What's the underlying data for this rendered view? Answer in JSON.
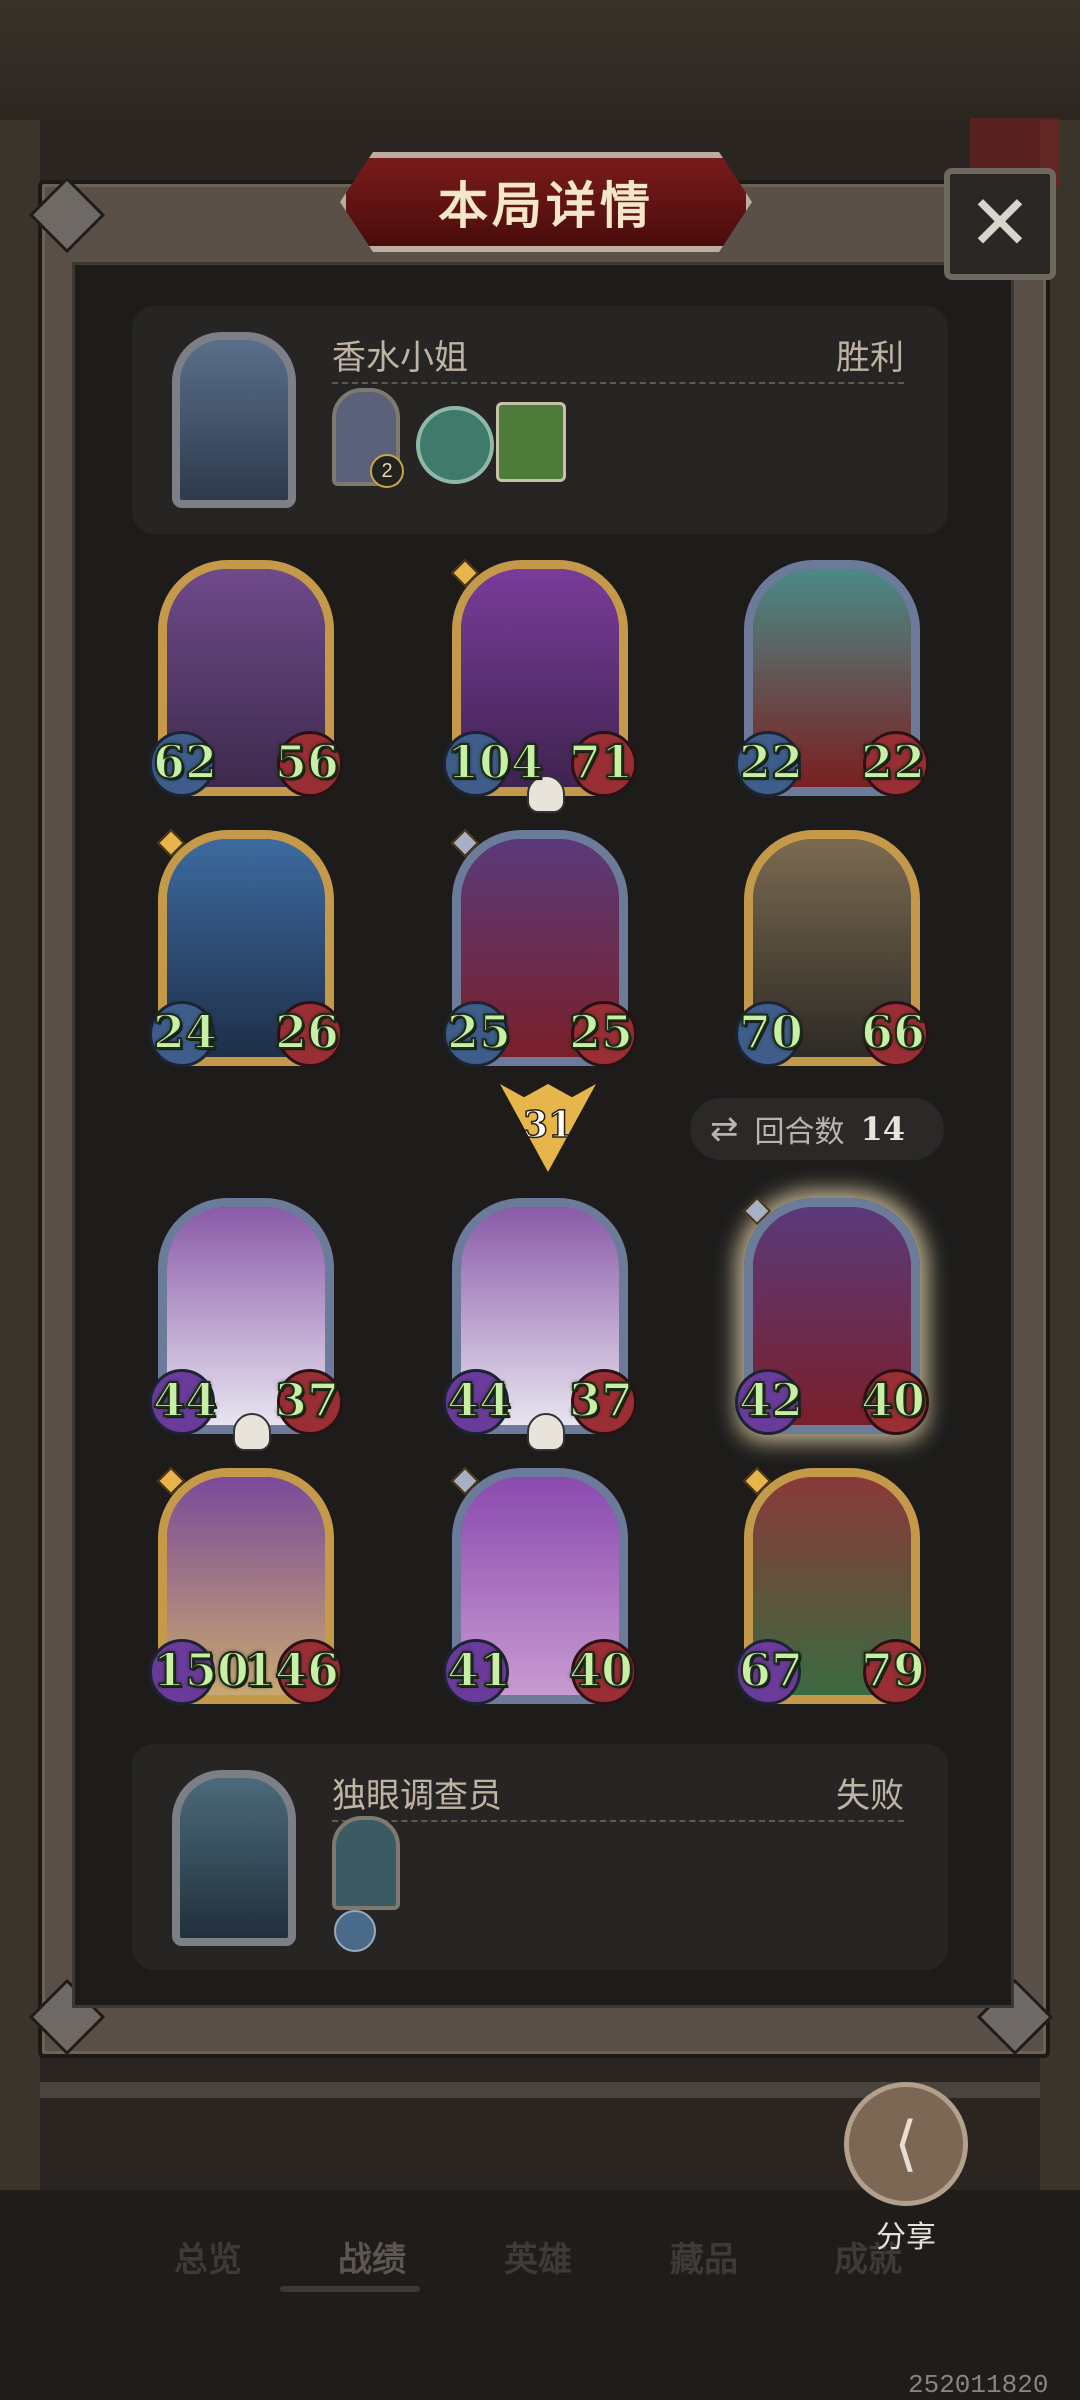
{
  "header": {
    "title": "本局详情",
    "close_icon": "close-icon"
  },
  "winner": {
    "name": "香水小姐",
    "result": "胜利",
    "item_badge": "2"
  },
  "loser": {
    "name": "独眼调查员",
    "result": "失败"
  },
  "winner_cards": [
    {
      "attack": "62",
      "health": "56"
    },
    {
      "attack": "104",
      "health": "71"
    },
    {
      "attack": "22",
      "health": "22"
    },
    {
      "attack": "24",
      "health": "26"
    },
    {
      "attack": "25",
      "health": "25"
    },
    {
      "attack": "70",
      "health": "66"
    }
  ],
  "loser_cards": [
    {
      "attack": "44",
      "health": "37"
    },
    {
      "attack": "44",
      "health": "37"
    },
    {
      "attack": "42",
      "health": "40"
    },
    {
      "attack": "150",
      "health": "146"
    },
    {
      "attack": "41",
      "health": "40"
    },
    {
      "attack": "67",
      "health": "79"
    }
  ],
  "round": {
    "marker": "31",
    "label": "回合数",
    "value": "14"
  },
  "nav": {
    "tabs": [
      "总览",
      "战绩",
      "英雄",
      "藏品",
      "成就"
    ],
    "active": "战绩"
  },
  "share": {
    "label": "分享"
  },
  "build_number": "252011820"
}
